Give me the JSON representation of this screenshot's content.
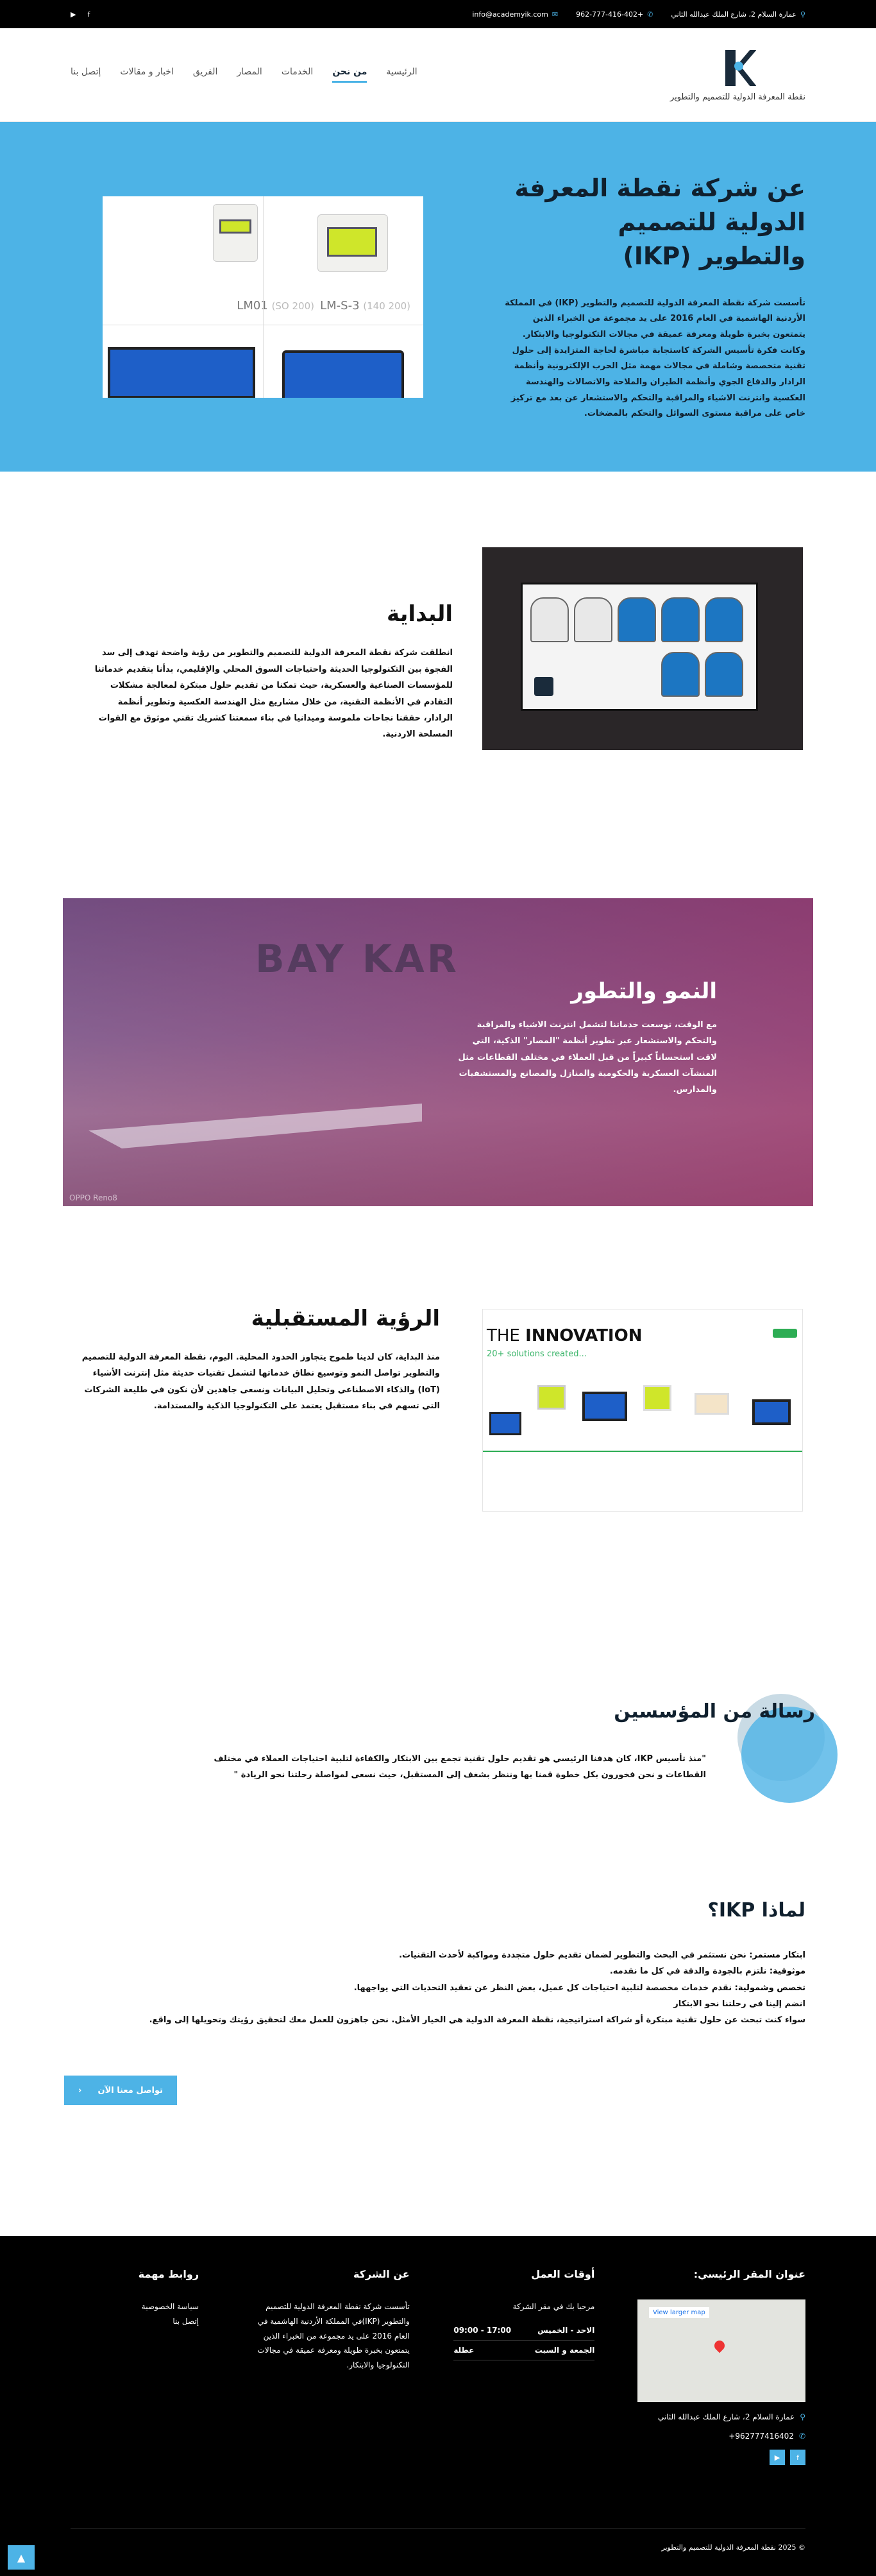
{
  "topbar": {
    "address": "عمارة السلام 2، شارع الملك عبدالله الثاني",
    "phone": "+962-777-416-402",
    "email": "info@academyik.com",
    "icons": [
      "youtube-icon",
      "facebook-icon"
    ]
  },
  "header": {
    "brand_name": "نقطة المعرفة الدولية للتصميم والتطوير",
    "nav": [
      "الرئيسية",
      "من نحن",
      "الخدمات",
      "المصار",
      "الفريق",
      "اخبار و مقالات",
      "إتصل بنا"
    ],
    "active_index": 1
  },
  "hero": {
    "title": "عن شركة نقطة المعرفة الدولية للتصميم والتطوير (IKP)",
    "body": "تأسست شركة نقطة المعرفة الدولية للتصميم والتطوير (IKP) في المملكة الأردنية الهاشمية في العام 2016 على يد مجموعة من الخبراء الذين يتمتعون بخبرة طويلة ومعرفة عميقة في مجالات التكنولوجيا والابتكار. وكانت فكرة تأسيس الشركة كاستجابة مباشرة لحاجة المتزايدة إلى حلول تقنية متخصصة وشاملة في مجالات مهمة مثل الحرب الإلكترونية وأنظمة الرادار والدفاع الجوي وأنظمة الطيران والملاحة والاتصالات والهندسة العكسية وانترنت الاشياء والمراقبة والتحكم والاستشعار عن بعد مع تركيز خاص على مراقبة مستوى السوائل والتحكم بالمضخات.",
    "products": [
      {
        "name": "LM01",
        "code": "(SO 200)"
      },
      {
        "name": "LM-S-3",
        "code": "(140 200)"
      }
    ]
  },
  "beginning": {
    "title": "البداية",
    "body": "انطلقت شركة نقطة المعرفة الدولية للتصميم والتطوير من رؤية واضحة تهدف إلى سد الفجوة بين التكنولوجيا الحديثة واحتياجات السوق المحلي والإقليمي، بدأنا بتقديم خدماتنا للمؤسسات الصناعية والعسكرية، حيث تمكنا من تقديم حلول مبتكرة لمعالجة مشكلات التقادم في الأنظمة التقنية، من خلال مشاريع مثل الهندسة العكسية وتطوير أنظمة الرادار، حققنا نجاحات ملموسة وميدانيا في بناء سمعتنا كشريك تقني موثوق مع القوات المسلحة الاردنية."
  },
  "growth": {
    "title": "النمو والتطور",
    "body": "مع الوقت، توسعت خدماتنا لتشمل انترنت الاشياء والمراقبة والتحكم والاستشعار عبر تطوير أنظمة \"المصار\" الذكية، التي لاقت استحساناً كبيراً من قبل العملاء في مختلف القطاعات مثل المنشآت العسكرية والحكومية والمنازل والمصانع والمستشفيات والمدارس.",
    "watermark": "OPPO Reno8"
  },
  "vision": {
    "title": "الرؤية المستقبلية",
    "body": "منذ البداية، كان لدينا طموح يتجاوز الحدود المحلية. اليوم، نقطة المعرفة الدولية للتصميم والتطوير تواصل النمو وتوسيع نطاق خدماتها لتشمل تقنيات حديثة مثل إنترنت الأشياء (IoT) والذكاء الاصطناعي وتحليل البيانات ونسعى جاهدين لأن نكون في طليعة الشركات التي تسهم في بناء مستقبل يعتمد على التكنولوجيا الذكية والمستدامة.",
    "image_title_prefix": "THE",
    "image_title": "INNOVATION",
    "image_subtitle": "20+ solutions created..."
  },
  "founders": {
    "title": "رسالة من المؤسسين",
    "quote": "\"منذ تأسيس IKP، كان هدفنا الرئيسي هو تقديم حلول تقنية تجمع بين الابتكار والكفاءة لتلبية احتياجات العملاء في مختلف القطاعات و نحن فخورون بكل خطوة قمنا بها وننظر بشغف إلى المستقبل، حيث نسعى لمواصلة رحلتنا نحو الريادة \""
  },
  "why": {
    "title": "لماذا IKP؟",
    "items": [
      {
        "label": "ابتكار مستمر:",
        "text": " نحن نستثمر في البحث والتطوير لضمان تقديم حلول متجددة ومواكبة لأحدث التقنيات."
      },
      {
        "label": "موثوقية:",
        "text": " نلتزم بالجودة والدقة في كل ما نقدمه."
      },
      {
        "label": "تخصص وشمولية:",
        "text": " نقدم خدمات مخصصة لتلبية احتياجات كل عميل، بغض النظر عن تعقيد التحديات التي يواجهها."
      },
      {
        "label": "",
        "text": "انضم إلينا في رحلتنا نحو الابتكار"
      },
      {
        "label": "",
        "text": "سواء كنت تبحث عن حلول تقنية مبتكرة أو شراكة استراتيجية، نقطة المعرفة الدولية هي الخيار الأمثل. نحن جاهزون للعمل معك لتحقيق رؤيتك وتحويلها إلى واقع."
      }
    ],
    "cta": "تواصل معنا الآن"
  },
  "footer": {
    "address_title": "عنوان المقر الرئيسي:",
    "map_button": "View larger map",
    "address": "عمارة السلام 2، شارع الملك عبدالله الثاني",
    "phone": "+962777416402",
    "hours_title": "أوقات العمل",
    "hours_intro": "مرحبا بك في مقر الشركة",
    "hours": [
      {
        "day": "الاحد - الخميس",
        "time": "09:00 - 17:00"
      },
      {
        "day": "الجمعة و السبت",
        "time": "عطلة"
      }
    ],
    "about_title": "عن الشركة",
    "about_text": "تأسست شركة نقطة المعرفة الدولية للتصميم والتطوير (IKP)في المملكة الأردنية الهاشمية في العام 2016 على يد مجموعة من الخبراء الذين يتمتعون بخبرة طويلة ومعرفة عميقة في مجالات التكنولوجيا والابتكار.",
    "links_title": "روابط مهمة",
    "links": [
      "سياسة الخصوصية",
      "إتصل بنا"
    ],
    "copyright": "© 2025 نقطة المعرفة الدولية للتصميم والتطوير"
  }
}
